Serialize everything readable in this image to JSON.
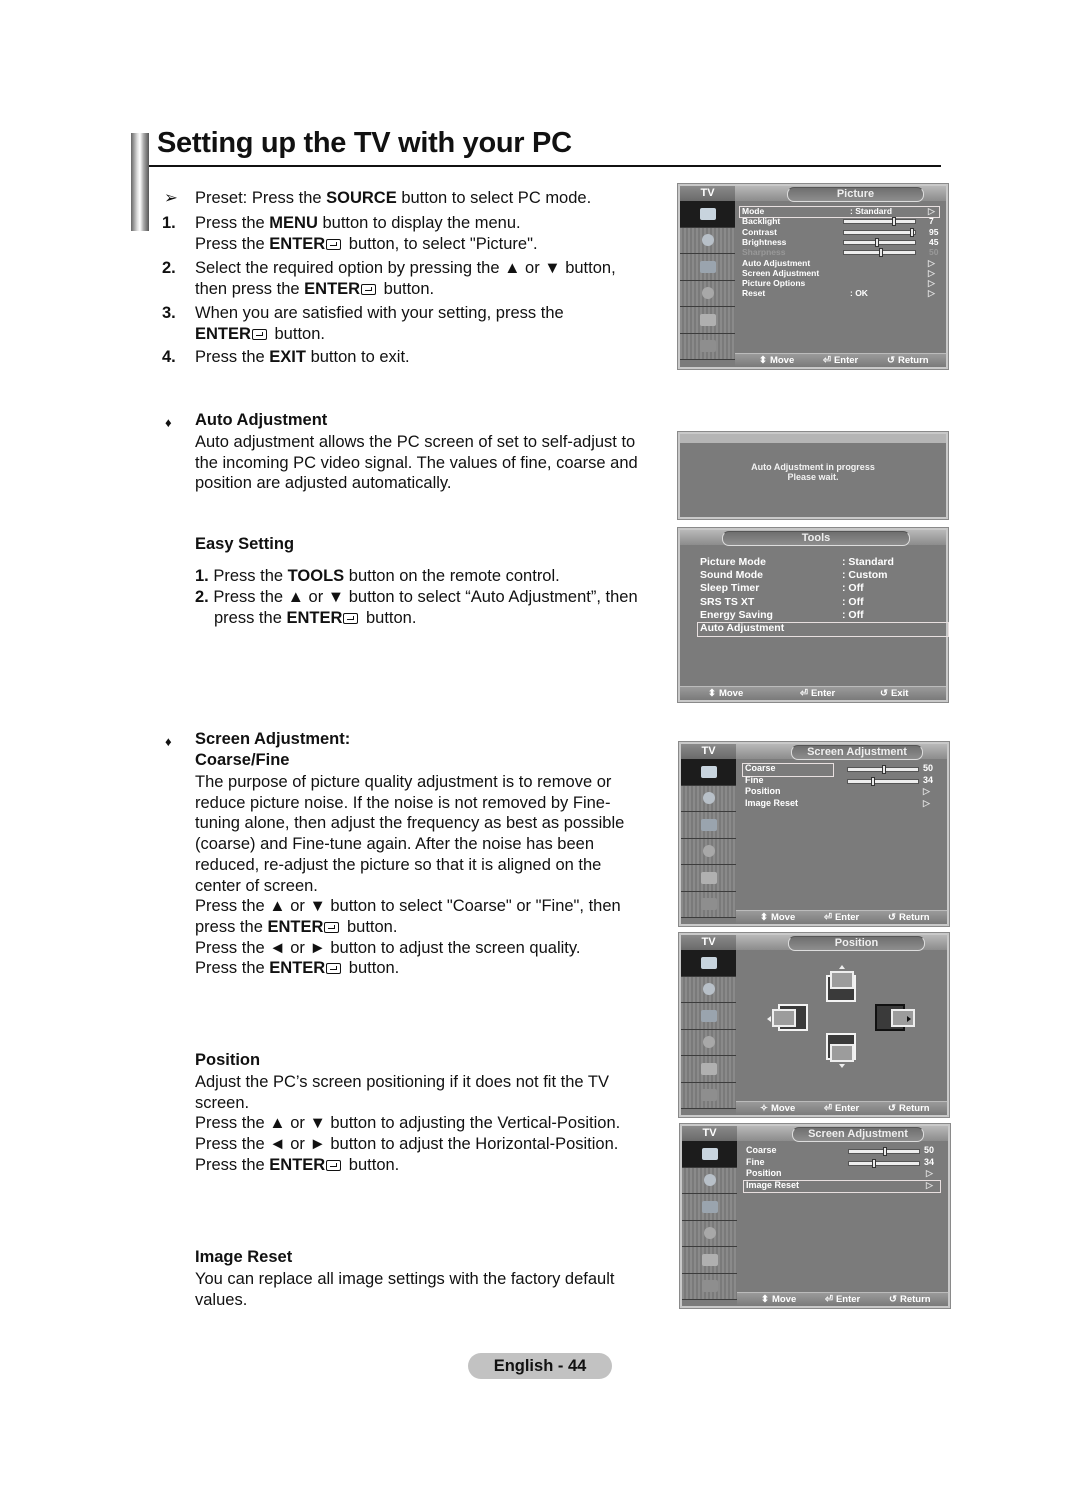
{
  "title": "Setting up the TV with your PC",
  "intro": {
    "preset_marker": "➢",
    "preset_pre": "Preset: Press the ",
    "preset_key": "SOURCE",
    "preset_post": " button to select PC mode.",
    "steps": [
      {
        "num": "1.",
        "lines": [
          {
            "pre": "Press the ",
            "key": "MENU",
            "post": " button to display the menu.",
            "enter": false
          },
          {
            "pre": "Press the ",
            "key": "ENTER",
            "post": " button, to select \"Picture\".",
            "enter": true
          }
        ]
      },
      {
        "num": "2.",
        "lines": [
          {
            "pre": "Select the required option by pressing the ▲ or ▼ button,",
            "key": "",
            "post": "",
            "enter": false
          },
          {
            "pre": "then press the ",
            "key": "ENTER",
            "post": " button.",
            "enter": true
          }
        ]
      },
      {
        "num": "3.",
        "lines": [
          {
            "pre": "When you are satisfied with your setting, press the",
            "key": "",
            "post": "",
            "enter": false
          },
          {
            "pre": "",
            "key": "ENTER",
            "post": " button.",
            "enter": true
          }
        ]
      },
      {
        "num": "4.",
        "lines": [
          {
            "pre": "Press the ",
            "key": "EXIT",
            "post": " button to exit.",
            "enter": false
          }
        ]
      }
    ]
  },
  "auto_adjustment": {
    "bullet": "♦",
    "heading": "Auto Adjustment",
    "body": [
      "Auto adjustment allows the PC screen of set to self-adjust to",
      "the incoming PC video signal. The values of fine, coarse and",
      "position are adjusted automatically."
    ]
  },
  "easy_setting": {
    "heading": "Easy Setting",
    "step1_num": "1.",
    "step1_pre": " Press the ",
    "step1_key": "TOOLS",
    "step1_post": " button on the remote control.",
    "step2_num": "2.",
    "step2_line1": " Press the ▲ or ▼ button to select “Auto Adjustment”, then",
    "step2_pre": "press the ",
    "step2_key": "ENTER",
    "step2_post": " button."
  },
  "screen_adjustment": {
    "bullet": "♦",
    "heading1": "Screen Adjustment:",
    "heading2": "Coarse/Fine",
    "body": [
      "The purpose of picture quality adjustment is to remove or",
      "reduce picture noise. If the noise is not removed by Fine-",
      "tuning alone, then adjust the frequency as best as possible",
      "(coarse) and Fine-tune again. After the noise has been",
      "reduced, re-adjust the picture so that it is aligned on the",
      "center of screen.",
      "Press the ▲ or ▼ button to select \"Coarse\" or \"Fine\", then"
    ],
    "enter_line_pre": "press the ",
    "enter_key": "ENTER",
    "enter_line_post": " button.",
    "line_lr": "Press the ◄ or ► button to adjust the screen quality.",
    "last_pre": "Press the ",
    "last_key": "ENTER",
    "last_post": " button."
  },
  "position": {
    "heading": "Position",
    "body": [
      "Adjust the PC’s screen positioning if it does not fit the TV",
      "screen.",
      "Press the ▲ or ▼ button to adjusting the Vertical-Position.",
      "Press the ◄ or ► button to adjust the Horizontal-Position."
    ],
    "last_pre": "Press the ",
    "last_key": "ENTER",
    "last_post": " button."
  },
  "image_reset": {
    "heading": "Image Reset",
    "body": [
      "You can replace all image settings with the factory default",
      "values."
    ]
  },
  "footer": {
    "page_label": "English - 44"
  },
  "osd_common": {
    "tv_label": "TV",
    "move": "Move",
    "enter": "Enter",
    "return": "Return",
    "exit": "Exit",
    "tabs": [
      "picture-icon",
      "sound-icon",
      "channel-icon",
      "setup-icon",
      "input-icon",
      "application-icon"
    ]
  },
  "osd_picture": {
    "title": "Picture",
    "rows": [
      {
        "label": "Mode",
        "value": ": Standard",
        "arrow": "▷",
        "selected": true
      },
      {
        "label": "Backlight",
        "slider": 7,
        "max": 10,
        "value": "7"
      },
      {
        "label": "Contrast",
        "slider": 95,
        "max": 100,
        "value": "95"
      },
      {
        "label": "Brightness",
        "slider": 45,
        "max": 100,
        "value": "45"
      },
      {
        "label": "Sharpness",
        "slider": 50,
        "max": 100,
        "value": "50",
        "dim": true
      },
      {
        "label": "Auto Adjustment",
        "arrow": "▷"
      },
      {
        "label": "Screen Adjustment",
        "arrow": "▷"
      },
      {
        "label": "Picture Options",
        "arrow": "▷"
      },
      {
        "label": "Reset",
        "value": ": OK",
        "arrow": "▷"
      }
    ]
  },
  "osd_progress": {
    "line1": "Auto Adjustment in progress",
    "line2": "Please wait."
  },
  "osd_tools": {
    "title": "Tools",
    "rows": [
      {
        "label": "Picture Mode",
        "value": ": Standard"
      },
      {
        "label": "Sound Mode",
        "value": ": Custom"
      },
      {
        "label": "Sleep Timer",
        "value": ": Off"
      },
      {
        "label": "SRS TS XT",
        "value": ": Off"
      },
      {
        "label": "Energy Saving",
        "value": ": Off"
      },
      {
        "label": "Auto Adjustment",
        "value": "",
        "selected": true
      }
    ]
  },
  "osd_screen_adj_1": {
    "title": "Screen Adjustment",
    "rows": [
      {
        "label": "Coarse",
        "slider": 50,
        "max": 100,
        "value": "50",
        "selected": true
      },
      {
        "label": "Fine",
        "slider": 34,
        "max": 100,
        "value": "34"
      },
      {
        "label": "Position",
        "arrow": "▷"
      },
      {
        "label": "Image Reset",
        "arrow": "▷"
      }
    ]
  },
  "osd_position": {
    "title": "Position"
  },
  "osd_screen_adj_2": {
    "title": "Screen Adjustment",
    "rows": [
      {
        "label": "Coarse",
        "slider": 50,
        "max": 100,
        "value": "50"
      },
      {
        "label": "Fine",
        "slider": 34,
        "max": 100,
        "value": "34"
      },
      {
        "label": "Position",
        "arrow": "▷"
      },
      {
        "label": "Image Reset",
        "arrow": "▷",
        "selected": true
      }
    ]
  }
}
